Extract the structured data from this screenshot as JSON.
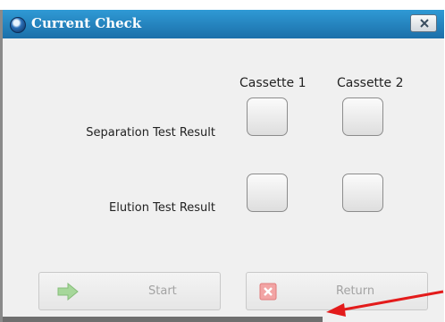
{
  "window": {
    "title": "Current Check",
    "icon": "app-logo-icon",
    "close_icon": "close-icon"
  },
  "columns": [
    "Cassette 1",
    "Cassette 2"
  ],
  "rows": [
    {
      "label": "Separation Test Result"
    },
    {
      "label": "Elution Test Result"
    }
  ],
  "buttons": {
    "start": {
      "label": "Start",
      "icon": "green-arrow-icon"
    },
    "return": {
      "label": "Return",
      "icon": "red-x-icon"
    }
  },
  "annotation": {
    "color": "#e31b1b"
  }
}
